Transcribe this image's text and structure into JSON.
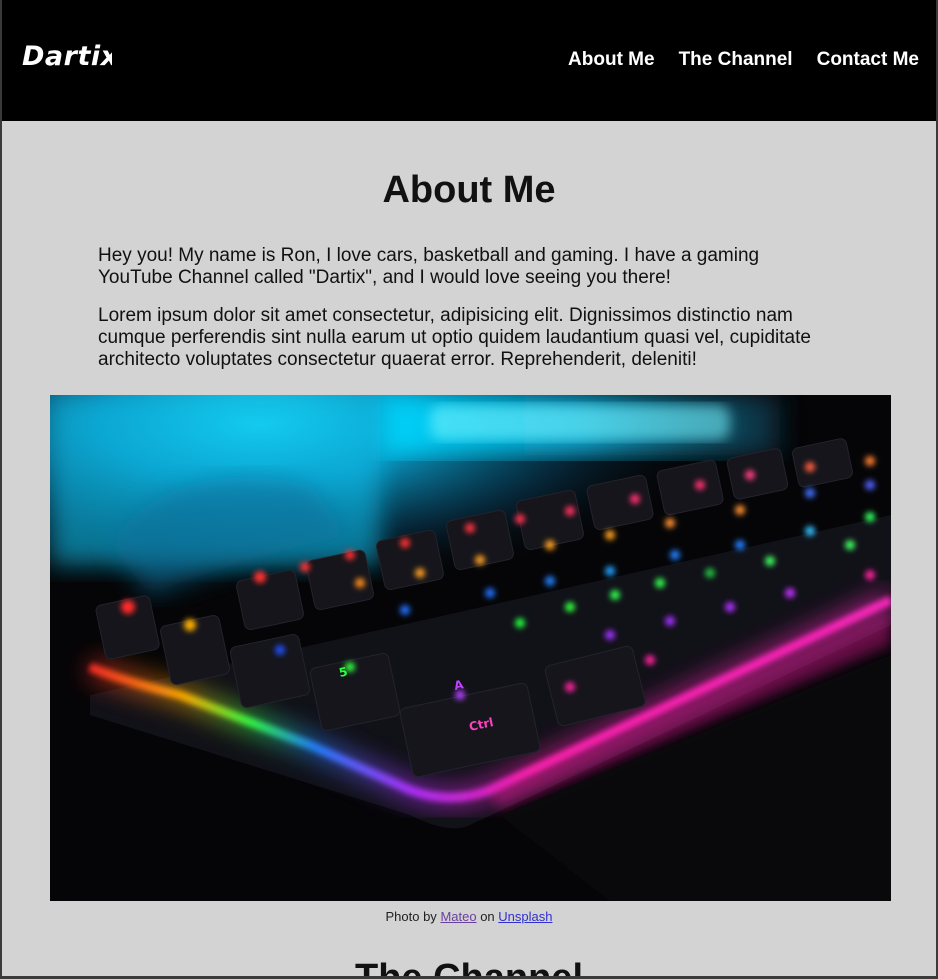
{
  "header": {
    "logo_text": "Dartix",
    "nav": [
      {
        "label": "About Me"
      },
      {
        "label": "The Channel"
      },
      {
        "label": "Contact Me"
      }
    ]
  },
  "about": {
    "title": "About Me",
    "paragraph1": "Hey you! My name is Ron, I love cars, basketball and gaming. I have a gaming YouTube Channel called \"Dartix\", and I would love seeing you there!",
    "paragraph2": "Lorem ipsum dolor sit amet consectetur, adipisicing elit. Dignissimos distinctio nam cumque perferendis sint nulla earum ut optio quidem laudantium quasi vel, cupiditate architecto voluptates consectetur quaerat error. Reprehenderit, deleniti!"
  },
  "photo": {
    "caption_prefix": "Photo by",
    "author": "Mateo",
    "caption_middle": "on",
    "site": "Unsplash",
    "key_labels": [
      "Ctrl",
      "A",
      "5"
    ]
  },
  "channel": {
    "title": "The Channel"
  },
  "colors": {
    "header_bg": "#000000",
    "page_bg": "#d3d3d3",
    "nav_text": "#ffffff",
    "glow_cyan": "#00e5ff",
    "glow_pink": "#ff1aa8"
  }
}
